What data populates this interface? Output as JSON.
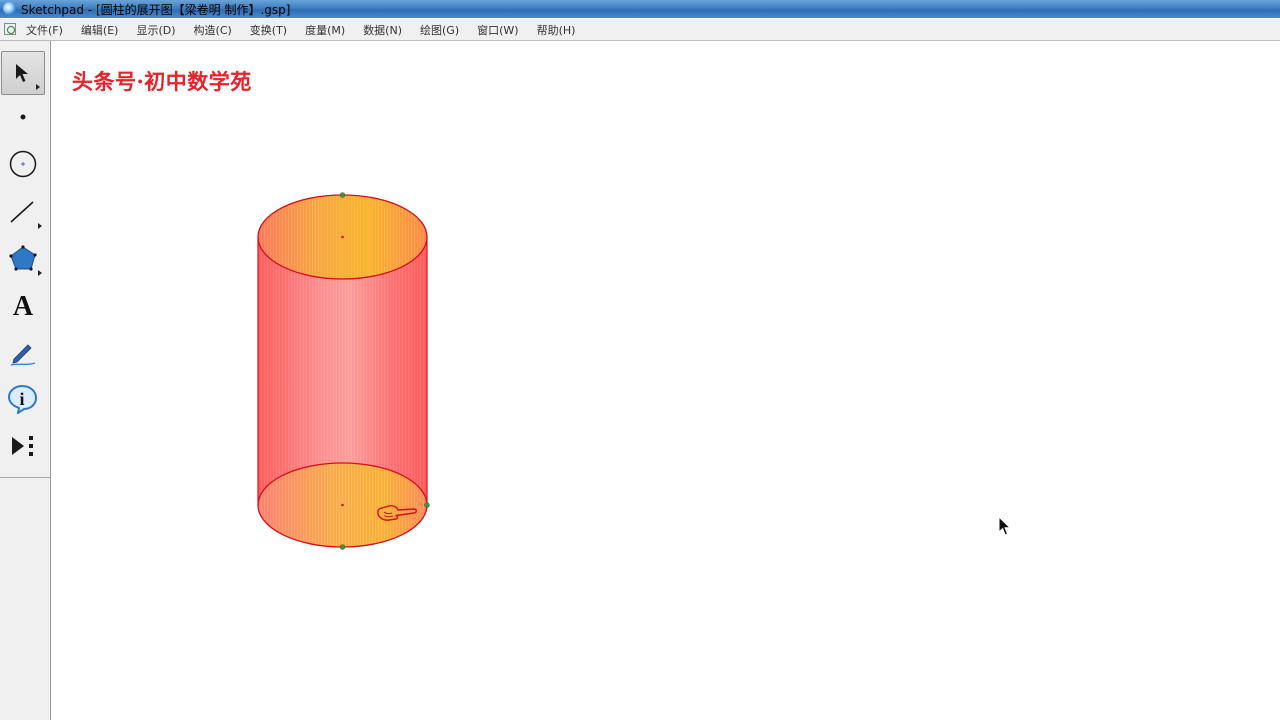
{
  "window": {
    "title": "Sketchpad  - [圆柱的展开图【梁卷明 制作】.gsp]",
    "app_icon": "sketchpad-app-icon"
  },
  "menubar": {
    "doc_icon": "document-icon",
    "items": [
      {
        "label": "文件(F)"
      },
      {
        "label": "编辑(E)"
      },
      {
        "label": "显示(D)"
      },
      {
        "label": "构造(C)"
      },
      {
        "label": "变换(T)"
      },
      {
        "label": "度量(M)"
      },
      {
        "label": "数据(N)"
      },
      {
        "label": "绘图(G)"
      },
      {
        "label": "窗口(W)"
      },
      {
        "label": "帮助(H)"
      }
    ]
  },
  "toolbox": {
    "tools": [
      {
        "name": "selection-arrow-tool",
        "icon": "arrow-icon",
        "selected": true
      },
      {
        "name": "point-tool",
        "icon": "point-icon"
      },
      {
        "name": "compass-tool",
        "icon": "circle-icon"
      },
      {
        "name": "straightedge-tool",
        "icon": "segment-icon"
      },
      {
        "name": "polygon-tool",
        "icon": "pentagon-icon"
      },
      {
        "name": "text-tool",
        "icon": "letter-a-icon",
        "glyph": "A"
      },
      {
        "name": "marker-tool",
        "icon": "pen-icon"
      },
      {
        "name": "information-tool",
        "icon": "info-icon",
        "glyph": "i"
      },
      {
        "name": "custom-tool",
        "icon": "play-menu-icon"
      }
    ]
  },
  "canvas": {
    "watermark": "头条号·初中数学苑",
    "figure": "cylinder",
    "colors": {
      "cylinder_side": "#ff6a6a",
      "cylinder_cap": "#f7b22e",
      "outline": "#d4101c",
      "point": "#2e7d32",
      "hand_icon": "#d4101c",
      "watermark": "#e8212a"
    },
    "hand_icon": "pointing-hand-icon",
    "cursor_icon": "mouse-cursor-icon"
  }
}
